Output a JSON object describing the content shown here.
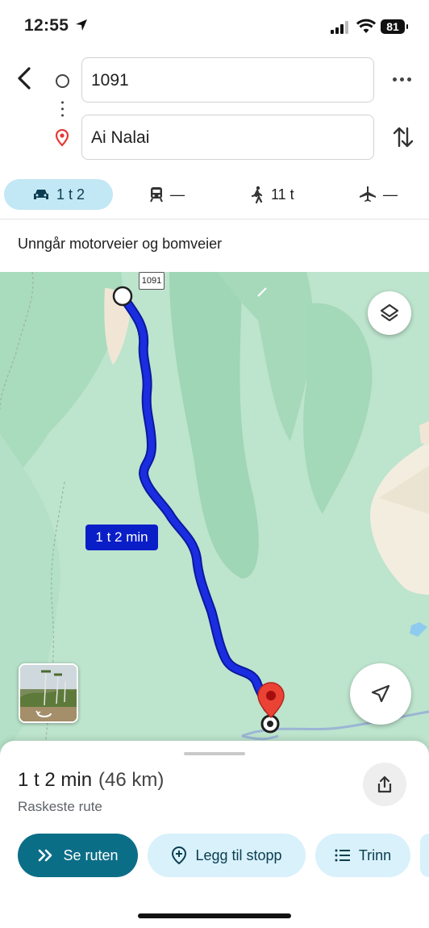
{
  "status": {
    "time": "12:55",
    "battery": "81"
  },
  "search": {
    "origin": "1091",
    "destination": "Ai Nalai"
  },
  "modes": [
    {
      "label": "1 t 2",
      "icon": "car-icon",
      "active": true
    },
    {
      "label": "—",
      "icon": "train-icon"
    },
    {
      "label": "11 t",
      "icon": "walk-icon"
    },
    {
      "label": "—",
      "icon": "plane-icon"
    }
  ],
  "avoid_text": "Unngår motorveier og bomveier",
  "map": {
    "road_shield": "1091",
    "route_label": "1 t 2 min",
    "route_color": "#1a2de0"
  },
  "summary": {
    "time": "1 t 2 min",
    "distance": "(46 km)",
    "subtitle": "Raskeste rute"
  },
  "actions": {
    "route": "Se ruten",
    "add_stop": "Legg til stopp",
    "steps": "Trinn"
  }
}
